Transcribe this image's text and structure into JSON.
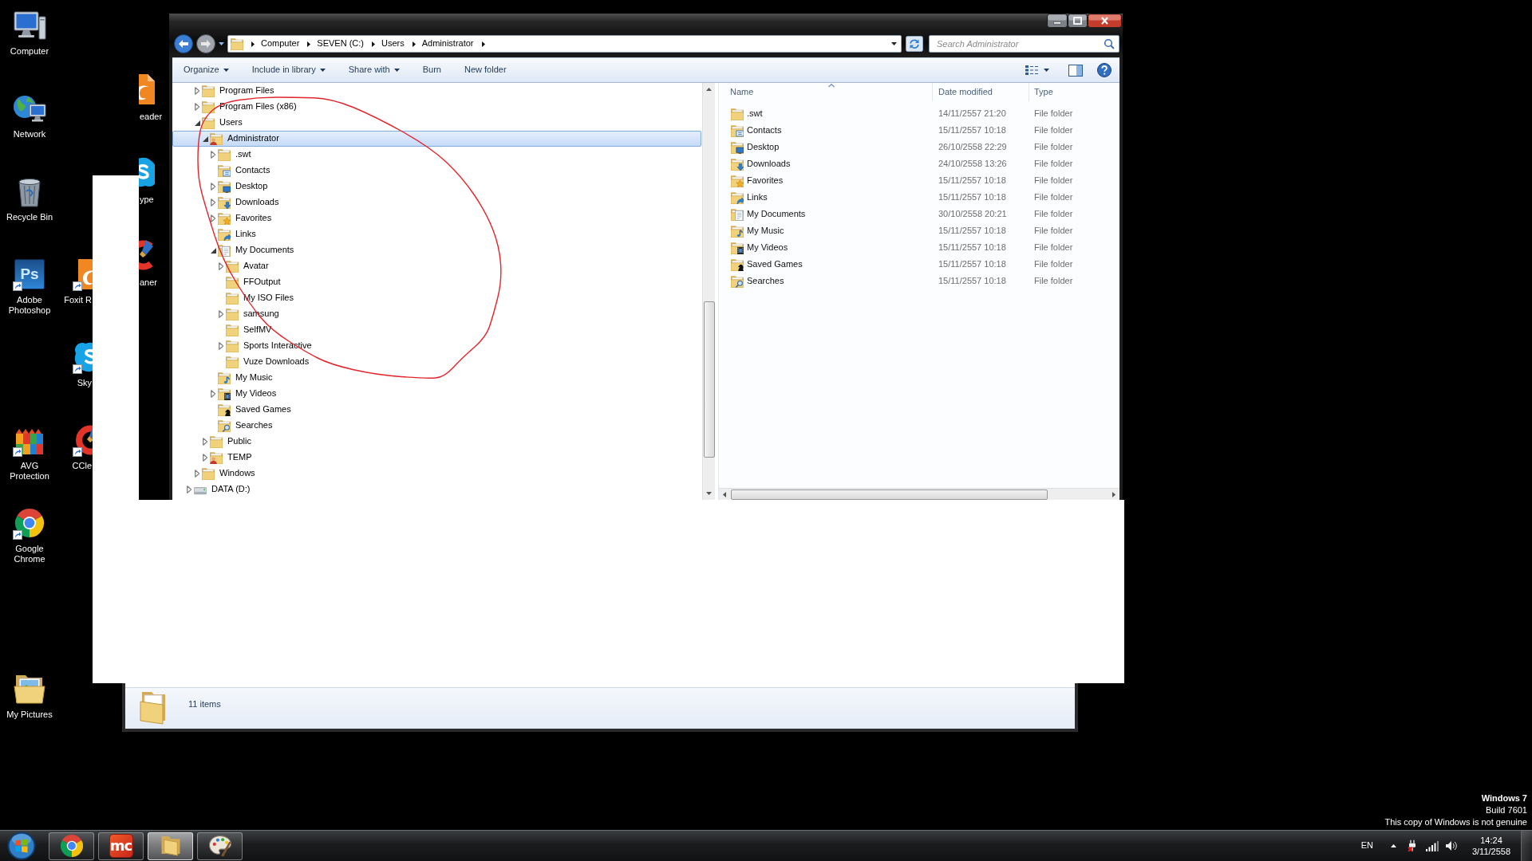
{
  "desktop_icons": [
    {
      "label": "Computer",
      "kind": "computer",
      "shortcut": false
    },
    {
      "label": "Network",
      "kind": "network",
      "shortcut": false
    },
    {
      "label": "Recycle Bin",
      "kind": "recycle_bin",
      "shortcut": false
    },
    {
      "label": "Adobe Photoshop",
      "kind": "ps",
      "shortcut": true,
      "logo_text": "Ps"
    },
    {
      "label": "AVG Protection",
      "kind": "avg",
      "shortcut": true
    },
    {
      "label": "Google Chrome",
      "kind": "chrome",
      "shortcut": true
    },
    {
      "label": "My Pictures",
      "kind": "pictures",
      "shortcut": false
    },
    {
      "label": "Foxit R",
      "kind": "pdf",
      "shortcut": true
    },
    {
      "label": "Sky",
      "kind": "skype",
      "shortcut": true
    },
    {
      "label": "CCle",
      "kind": "ccleaner",
      "shortcut": true
    },
    {
      "label": "eader",
      "kind": "pdf",
      "shortcut": false
    },
    {
      "label": "ype",
      "kind": "skype",
      "shortcut": false
    },
    {
      "label": "aner",
      "kind": "ccleaner",
      "shortcut": false
    }
  ],
  "explorer": {
    "breadcrumbs": [
      "Computer",
      "SEVEN (C:)",
      "Users",
      "Administrator"
    ],
    "search": {
      "placeholder": "Search Administrator"
    },
    "toolbar": [
      {
        "label": "Organize",
        "dropdown": true
      },
      {
        "label": "Include in library",
        "dropdown": true
      },
      {
        "label": "Share with",
        "dropdown": true
      },
      {
        "label": "Burn",
        "dropdown": false
      },
      {
        "label": "New folder",
        "dropdown": false
      }
    ],
    "tree": {
      "hidden_drive_children": [
        {
          "label": "Program Files",
          "kind": "folder",
          "expandable": true,
          "expanded": false,
          "selected": false
        },
        {
          "label": "Program Files (x86)",
          "kind": "folder",
          "expandable": true,
          "expanded": false,
          "selected": false
        },
        {
          "label": "Users",
          "kind": "folder",
          "expandable": true,
          "expanded": true,
          "selected": false,
          "children": [
            {
              "label": "Administrator",
              "kind": "user",
              "expandable": true,
              "expanded": true,
              "selected": true,
              "children": [
                {
                  "label": ".swt",
                  "kind": "folder",
                  "expandable": true,
                  "expanded": false,
                  "selected": false
                },
                {
                  "label": "Contacts",
                  "kind": "contacts",
                  "expandable": false,
                  "expanded": false,
                  "selected": false
                },
                {
                  "label": "Desktop",
                  "kind": "desktop",
                  "expandable": true,
                  "expanded": false,
                  "selected": false
                },
                {
                  "label": "Downloads",
                  "kind": "downloads",
                  "expandable": true,
                  "expanded": false,
                  "selected": false
                },
                {
                  "label": "Favorites",
                  "kind": "favorites",
                  "expandable": true,
                  "expanded": false,
                  "selected": false
                },
                {
                  "label": "Links",
                  "kind": "links",
                  "expandable": false,
                  "expanded": false,
                  "selected": false
                },
                {
                  "label": "My Documents",
                  "kind": "documents",
                  "expandable": true,
                  "expanded": true,
                  "selected": false,
                  "children": [
                    {
                      "label": "Avatar",
                      "kind": "folder",
                      "expandable": true,
                      "expanded": false,
                      "selected": false
                    },
                    {
                      "label": "FFOutput",
                      "kind": "folder",
                      "expandable": false,
                      "expanded": false,
                      "selected": false
                    },
                    {
                      "label": "My ISO Files",
                      "kind": "folder",
                      "expandable": false,
                      "expanded": false,
                      "selected": false
                    },
                    {
                      "label": "samsung",
                      "kind": "folder",
                      "expandable": true,
                      "expanded": false,
                      "selected": false
                    },
                    {
                      "label": "SelfMV",
                      "kind": "folder",
                      "expandable": false,
                      "expanded": false,
                      "selected": false
                    },
                    {
                      "label": "Sports Interactive",
                      "kind": "folder",
                      "expandable": true,
                      "expanded": false,
                      "selected": false
                    },
                    {
                      "label": "Vuze Downloads",
                      "kind": "folder",
                      "expandable": false,
                      "expanded": false,
                      "selected": false
                    }
                  ]
                },
                {
                  "label": "My Music",
                  "kind": "music",
                  "expandable": false,
                  "expanded": false,
                  "selected": false
                },
                {
                  "label": "My Videos",
                  "kind": "videos",
                  "expandable": true,
                  "expanded": false,
                  "selected": false
                },
                {
                  "label": "Saved Games",
                  "kind": "games",
                  "expandable": false,
                  "expanded": false,
                  "selected": false
                },
                {
                  "label": "Searches",
                  "kind": "searches",
                  "expandable": false,
                  "expanded": false,
                  "selected": false
                }
              ]
            },
            {
              "label": "Public",
              "kind": "folder",
              "expandable": true,
              "expanded": false,
              "selected": false
            },
            {
              "label": "TEMP",
              "kind": "user",
              "expandable": true,
              "expanded": false,
              "selected": false
            }
          ]
        },
        {
          "label": "Windows",
          "kind": "folder",
          "expandable": true,
          "expanded": false,
          "selected": false
        }
      ],
      "items": [
        {
          "label": "DATA (D:)",
          "kind": "drive",
          "expandable": true,
          "expanded": false,
          "selected": false
        }
      ]
    },
    "columns": [
      {
        "label": "Name",
        "sorted": true
      },
      {
        "label": "Date modified",
        "sorted": false
      },
      {
        "label": "Type",
        "sorted": false
      }
    ],
    "files": [
      {
        "name": ".swt",
        "kind": "folder",
        "date_modified": "14/11/2557 21:20",
        "type": "File folder"
      },
      {
        "name": "Contacts",
        "kind": "contacts",
        "date_modified": "15/11/2557 10:18",
        "type": "File folder"
      },
      {
        "name": "Desktop",
        "kind": "desktop",
        "date_modified": "26/10/2558 22:29",
        "type": "File folder"
      },
      {
        "name": "Downloads",
        "kind": "downloads",
        "date_modified": "24/10/2558 13:26",
        "type": "File folder"
      },
      {
        "name": "Favorites",
        "kind": "favorites",
        "date_modified": "15/11/2557 10:18",
        "type": "File folder"
      },
      {
        "name": "Links",
        "kind": "links",
        "date_modified": "15/11/2557 10:18",
        "type": "File folder"
      },
      {
        "name": "My Documents",
        "kind": "documents",
        "date_modified": "30/10/2558 20:21",
        "type": "File folder"
      },
      {
        "name": "My Music",
        "kind": "music",
        "date_modified": "15/11/2557 10:18",
        "type": "File folder"
      },
      {
        "name": "My Videos",
        "kind": "videos",
        "date_modified": "15/11/2557 10:18",
        "type": "File folder"
      },
      {
        "name": "Saved Games",
        "kind": "games",
        "date_modified": "15/11/2557 10:18",
        "type": "File folder"
      },
      {
        "name": "Searches",
        "kind": "searches",
        "date_modified": "15/11/2557 10:18",
        "type": "File folder"
      }
    ],
    "status": "11 items"
  },
  "taskbar": {
    "apps": [
      {
        "kind": "chrome",
        "selected": false
      },
      {
        "kind": "mc",
        "selected": false,
        "logo_text": "mc"
      },
      {
        "kind": "explorer",
        "selected": true
      },
      {
        "kind": "paint",
        "selected": false
      }
    ],
    "language": "EN",
    "time": "14:24",
    "date": "3/11/2558"
  },
  "os_notice": {
    "edition": "Windows 7",
    "build": "Build 7601",
    "notice": "This copy of Windows is not genuine"
  }
}
